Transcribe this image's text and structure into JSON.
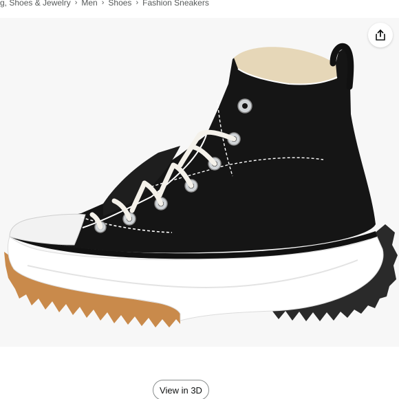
{
  "breadcrumb": {
    "items": [
      "g, Shoes & Jewelry",
      "Men",
      "Shoes",
      "Fashion Sneakers"
    ],
    "separator": "›"
  },
  "product_image": {
    "subject": "black high-top platform canvas sneaker",
    "icon": "sneaker-image"
  },
  "share": {
    "icon": "share-icon"
  },
  "view3d": {
    "label": "View in 3D"
  },
  "colors": {
    "panel_bg": "#f7f7f7",
    "canvas": "#151515",
    "sole": "#ffffff",
    "gum": "#c98a4b",
    "text_muted": "#565959"
  }
}
